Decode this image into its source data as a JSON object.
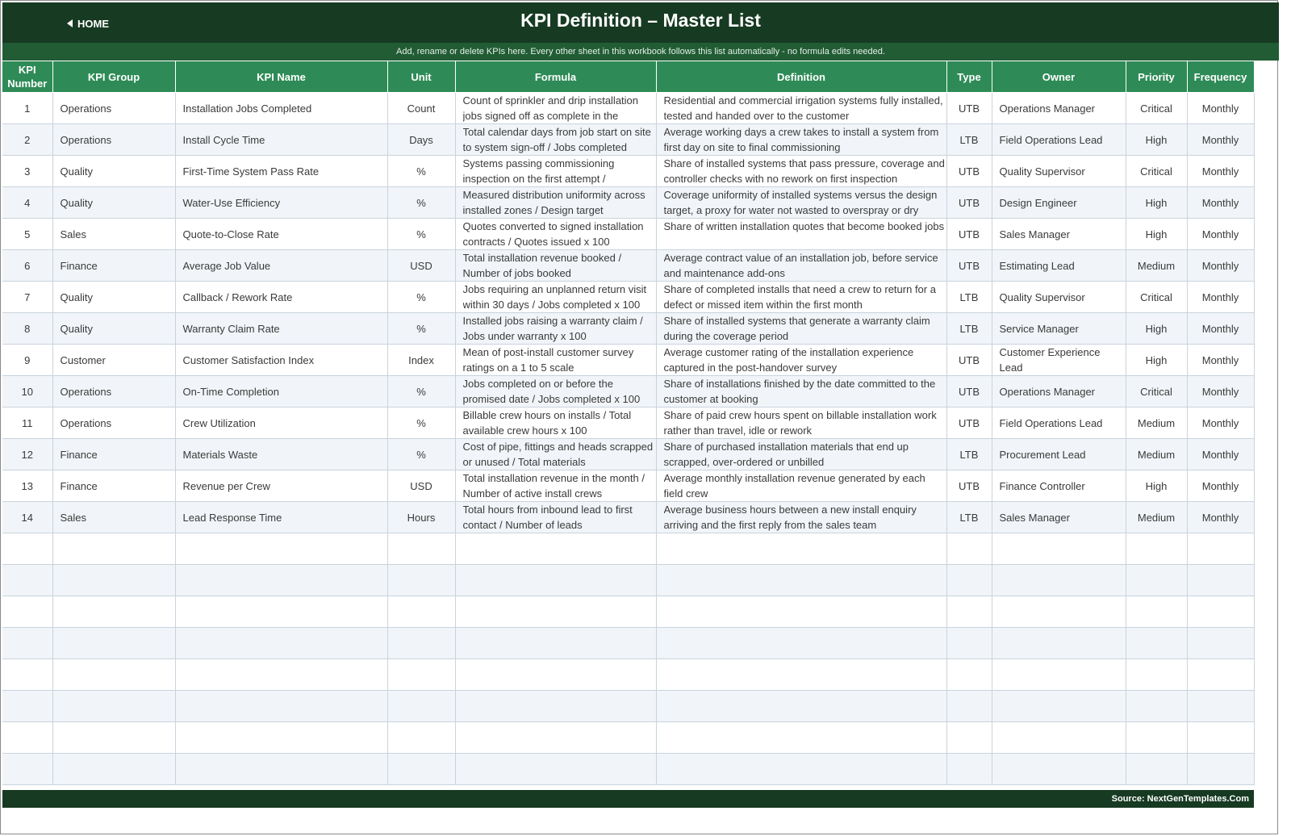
{
  "header": {
    "home_label": "HOME",
    "title": "KPI Definition  –  Master List",
    "subtitle": "Add, rename or delete KPIs here. Every other sheet in this workbook follows this list automatically - no formula edits needed."
  },
  "columns": [
    "KPI Number",
    "KPI Group",
    "KPI Name",
    "Unit",
    "Formula",
    "Definition",
    "Type",
    "Owner",
    "Priority",
    "Frequency"
  ],
  "rows": [
    {
      "num": "1",
      "group": "Operations",
      "name": "Installation Jobs Completed",
      "unit": "Count",
      "formula": "Count of sprinkler and drip installation jobs signed off as complete in the",
      "definition": "Residential and commercial irrigation systems fully installed, tested and handed over to the customer",
      "type": "UTB",
      "owner": "Operations Manager",
      "priority": "Critical",
      "frequency": "Monthly"
    },
    {
      "num": "2",
      "group": "Operations",
      "name": "Install Cycle Time",
      "unit": "Days",
      "formula": "Total calendar days from job start on site to system sign-off / Jobs completed",
      "definition": "Average working days a crew takes to install a system from first day on site to final commissioning",
      "type": "LTB",
      "owner": "Field Operations Lead",
      "priority": "High",
      "frequency": "Monthly"
    },
    {
      "num": "3",
      "group": "Quality",
      "name": "First-Time System Pass Rate",
      "unit": "%",
      "formula": "Systems passing commissioning inspection on the first attempt /",
      "definition": "Share of installed systems that pass pressure, coverage and controller checks with no rework on first inspection",
      "type": "UTB",
      "owner": "Quality Supervisor",
      "priority": "Critical",
      "frequency": "Monthly"
    },
    {
      "num": "4",
      "group": "Quality",
      "name": "Water-Use Efficiency",
      "unit": "%",
      "formula": "Measured distribution uniformity across installed zones / Design target",
      "definition": "Coverage uniformity of installed systems versus the design target, a proxy for water not wasted to overspray or dry",
      "type": "UTB",
      "owner": "Design Engineer",
      "priority": "High",
      "frequency": "Monthly"
    },
    {
      "num": "5",
      "group": "Sales",
      "name": "Quote-to-Close Rate",
      "unit": "%",
      "formula": "Quotes converted to signed installation contracts / Quotes issued x 100",
      "definition": "Share of written installation quotes that become booked jobs",
      "type": "UTB",
      "owner": "Sales Manager",
      "priority": "High",
      "frequency": "Monthly"
    },
    {
      "num": "6",
      "group": "Finance",
      "name": "Average Job Value",
      "unit": "USD",
      "formula": "Total installation revenue booked / Number of jobs booked",
      "definition": "Average contract value of an installation job, before service and maintenance add-ons",
      "type": "UTB",
      "owner": "Estimating Lead",
      "priority": "Medium",
      "frequency": "Monthly"
    },
    {
      "num": "7",
      "group": "Quality",
      "name": "Callback / Rework Rate",
      "unit": "%",
      "formula": "Jobs requiring an unplanned return visit within 30 days / Jobs completed x 100",
      "definition": "Share of completed installs that need a crew to return for a defect or missed item within the first month",
      "type": "LTB",
      "owner": "Quality Supervisor",
      "priority": "Critical",
      "frequency": "Monthly"
    },
    {
      "num": "8",
      "group": "Quality",
      "name": "Warranty Claim Rate",
      "unit": "%",
      "formula": "Installed jobs raising a warranty claim / Jobs under warranty x 100",
      "definition": "Share of installed systems that generate a warranty claim during the coverage period",
      "type": "LTB",
      "owner": "Service Manager",
      "priority": "High",
      "frequency": "Monthly"
    },
    {
      "num": "9",
      "group": "Customer",
      "name": "Customer Satisfaction Index",
      "unit": "Index",
      "formula": "Mean of post-install customer survey ratings on a 1 to 5 scale",
      "definition": "Average customer rating of the installation experience captured in the post-handover survey",
      "type": "UTB",
      "owner": "Customer Experience Lead",
      "priority": "High",
      "frequency": "Monthly"
    },
    {
      "num": "10",
      "group": "Operations",
      "name": "On-Time Completion",
      "unit": "%",
      "formula": "Jobs completed on or before the promised date / Jobs completed x 100",
      "definition": "Share of installations finished by the date committed to the customer at booking",
      "type": "UTB",
      "owner": "Operations Manager",
      "priority": "Critical",
      "frequency": "Monthly"
    },
    {
      "num": "11",
      "group": "Operations",
      "name": "Crew Utilization",
      "unit": "%",
      "formula": "Billable crew hours on installs / Total available crew hours x 100",
      "definition": "Share of paid crew hours spent on billable installation work rather than travel, idle or rework",
      "type": "UTB",
      "owner": "Field Operations Lead",
      "priority": "Medium",
      "frequency": "Monthly"
    },
    {
      "num": "12",
      "group": "Finance",
      "name": "Materials Waste",
      "unit": "%",
      "formula": "Cost of pipe, fittings and heads scrapped or unused / Total materials",
      "definition": "Share of purchased installation materials that end up scrapped, over-ordered or unbilled",
      "type": "LTB",
      "owner": "Procurement Lead",
      "priority": "Medium",
      "frequency": "Monthly"
    },
    {
      "num": "13",
      "group": "Finance",
      "name": "Revenue per Crew",
      "unit": "USD",
      "formula": "Total installation revenue in the month / Number of active install crews",
      "definition": "Average monthly installation revenue generated by each field crew",
      "type": "UTB",
      "owner": "Finance Controller",
      "priority": "High",
      "frequency": "Monthly"
    },
    {
      "num": "14",
      "group": "Sales",
      "name": "Lead Response Time",
      "unit": "Hours",
      "formula": "Total hours from inbound lead to first contact / Number of leads",
      "definition": "Average business hours between a new install enquiry arriving and the first reply from the sales team",
      "type": "LTB",
      "owner": "Sales Manager",
      "priority": "Medium",
      "frequency": "Monthly"
    }
  ],
  "footer": {
    "source": "Source: NextGenTemplates.Com"
  }
}
